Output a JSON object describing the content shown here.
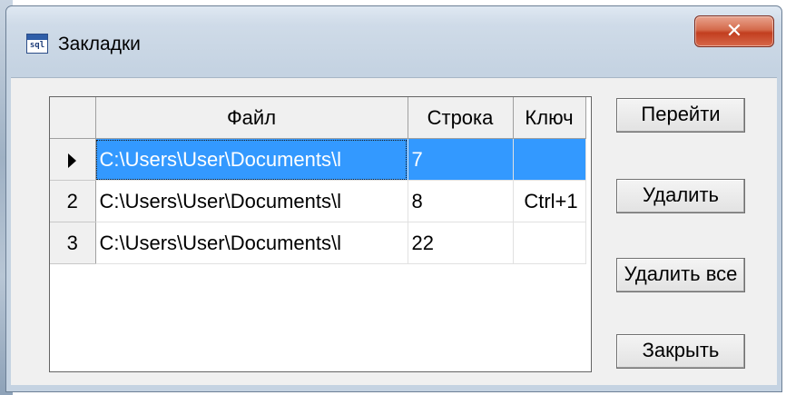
{
  "window": {
    "title": "Закладки",
    "icon_text": "sql",
    "close_glyph": "✕"
  },
  "grid": {
    "columns": [
      "Файл",
      "Строка",
      "Ключ"
    ],
    "rows": [
      {
        "num": "",
        "file": "C:\\Users\\User\\Documents\\l",
        "line": "7",
        "key": "",
        "selected": true
      },
      {
        "num": "2",
        "file": "C:\\Users\\User\\Documents\\l",
        "line": "8",
        "key": "Ctrl+1",
        "selected": false
      },
      {
        "num": "3",
        "file": "C:\\Users\\User\\Documents\\l",
        "line": "22",
        "key": "",
        "selected": false
      }
    ]
  },
  "buttons": {
    "goto": "Перейти",
    "delete": "Удалить",
    "delete_all": "Удалить все",
    "close": "Закрыть"
  },
  "colors": {
    "selection": "#3399ff",
    "close_button": "#c94a2b"
  }
}
